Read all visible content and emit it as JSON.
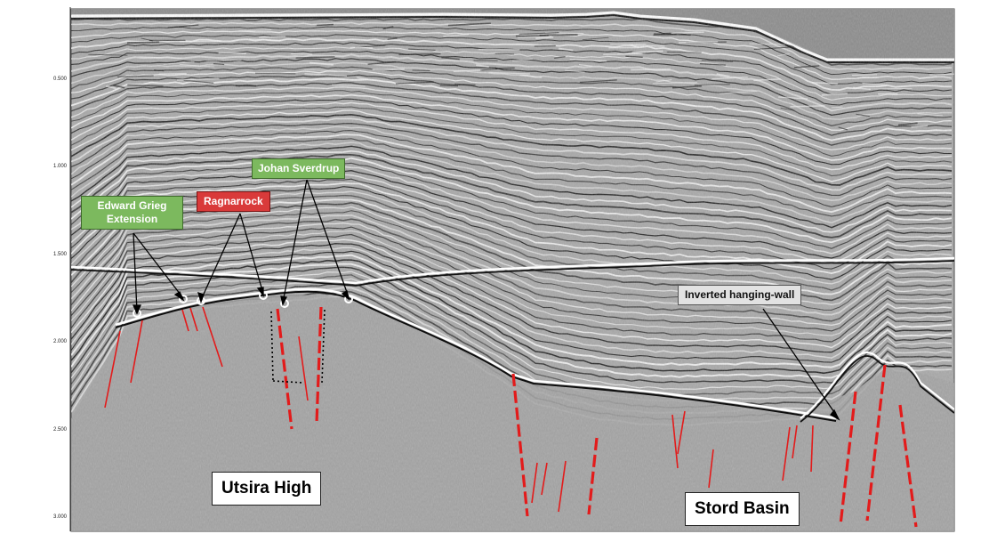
{
  "time_axis": {
    "ticks": [
      "0.500",
      "1.000",
      "1.500",
      "2.000",
      "2.500",
      "3.000"
    ]
  },
  "annotations": {
    "edward_grieg": "Edward Grieg\nExtension",
    "ragnarrock": "Ragnarrock",
    "johan_sverdrup": "Johan Sverdrup",
    "inverted_hanging_wall": "Inverted hanging-wall",
    "utsira_high": "Utsira High",
    "stord_basin": "Stord Basin"
  },
  "colors": {
    "green_label": "#7cb95e",
    "red_label": "#d93a3a",
    "fault_red": "#e31b1b",
    "gray_label": "#e2e2e2",
    "water_gray": "#8c8c8c"
  }
}
